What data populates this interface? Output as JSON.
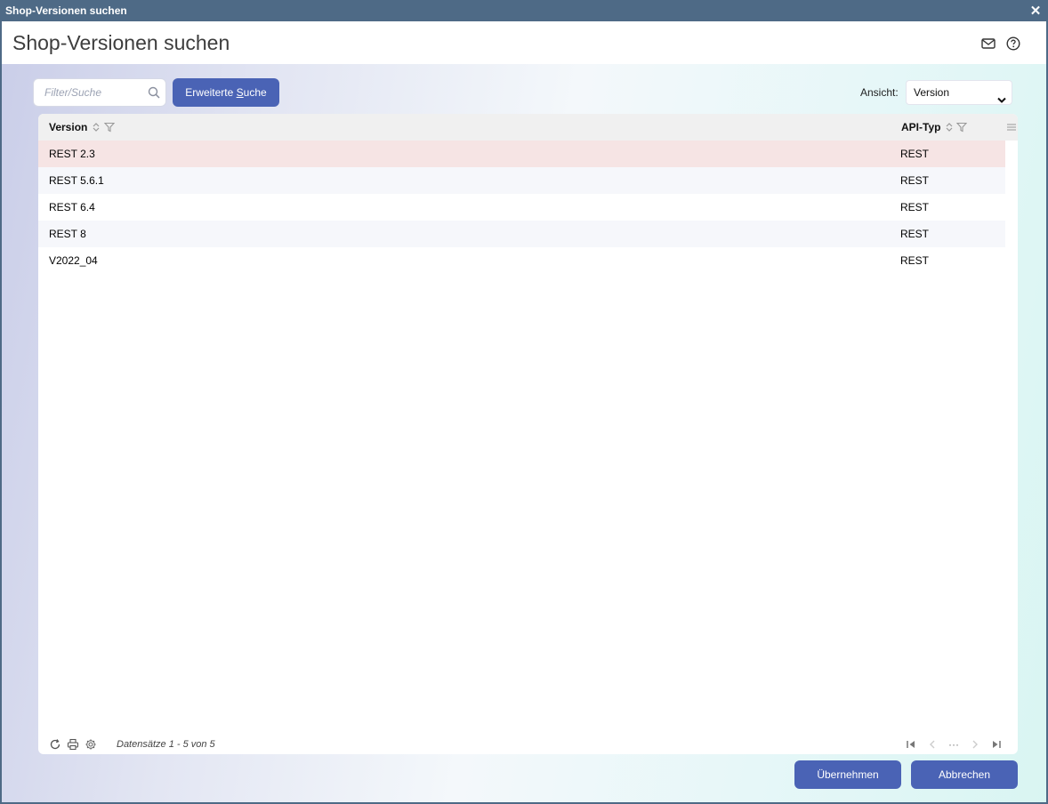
{
  "window": {
    "title": "Shop-Versionen suchen",
    "close_glyph": "✕"
  },
  "header": {
    "title": "Shop-Versionen suchen",
    "icons": [
      "mail-icon",
      "help-icon"
    ]
  },
  "toolbar": {
    "search_placeholder": "Filter/Suche",
    "search_value": "",
    "advanced_search_prefix": "Erweiterte ",
    "advanced_search_underlined": "S",
    "advanced_search_suffix": "uche",
    "view_label": "Ansicht:",
    "view_selected": "Version"
  },
  "grid": {
    "columns": [
      {
        "label": "Version"
      },
      {
        "label": "API-Typ"
      }
    ],
    "rows": [
      {
        "version": "REST 2.3",
        "api_type": "REST",
        "selected": true
      },
      {
        "version": "REST 5.6.1",
        "api_type": "REST",
        "selected": false
      },
      {
        "version": "REST 6.4",
        "api_type": "REST",
        "selected": false
      },
      {
        "version": "REST 8",
        "api_type": "REST",
        "selected": false
      },
      {
        "version": "V2022_04",
        "api_type": "REST",
        "selected": false
      }
    ],
    "record_count": "Datensätze 1 - 5 von 5",
    "pager_ellipsis": "···"
  },
  "actions": {
    "apply": "Übernehmen",
    "cancel": "Abbrechen"
  },
  "colors": {
    "titlebar": "#4e6a86",
    "accent": "#4a63b5",
    "selected_row": "#f6e4e4",
    "alt_row": "#f6f7fb"
  }
}
